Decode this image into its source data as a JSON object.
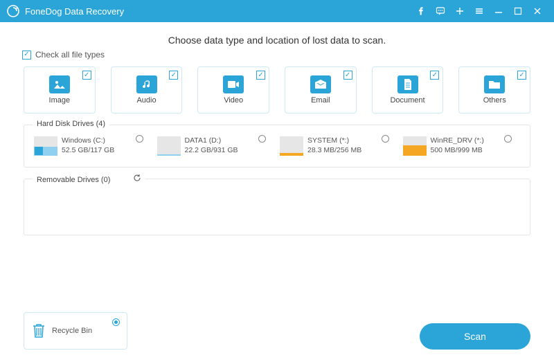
{
  "app": {
    "title": "FoneDog Data Recovery"
  },
  "heading": "Choose data type and location of lost data to scan.",
  "check_all_label": "Check all file types",
  "file_types": [
    {
      "label": "Image",
      "icon": "image-icon"
    },
    {
      "label": "Audio",
      "icon": "audio-icon"
    },
    {
      "label": "Video",
      "icon": "video-icon"
    },
    {
      "label": "Email",
      "icon": "email-icon"
    },
    {
      "label": "Document",
      "icon": "document-icon"
    },
    {
      "label": "Others",
      "icon": "folder-icon"
    }
  ],
  "hdd": {
    "legend": "Hard Disk Drives (4)",
    "drives": [
      {
        "name": "Windows (C:)",
        "size": "52.5 GB/117 GB",
        "fill_percent": 45,
        "color": "#8fcff0",
        "badge": true
      },
      {
        "name": "DATA1 (D:)",
        "size": "22.2 GB/931 GB",
        "fill_percent": 8,
        "color": "#8fcff0",
        "badge": false
      },
      {
        "name": "SYSTEM (*:)",
        "size": "28.3 MB/256 MB",
        "fill_percent": 15,
        "color": "#f5a623",
        "badge": false
      },
      {
        "name": "WinRE_DRV (*:)",
        "size": "500 MB/999 MB",
        "fill_percent": 55,
        "color": "#f5a623",
        "badge": false
      }
    ]
  },
  "removable": {
    "legend": "Removable Drives (0)"
  },
  "recycle": {
    "label": "Recycle Bin"
  },
  "scan_label": "Scan",
  "colors": {
    "accent": "#2ba5d8"
  }
}
